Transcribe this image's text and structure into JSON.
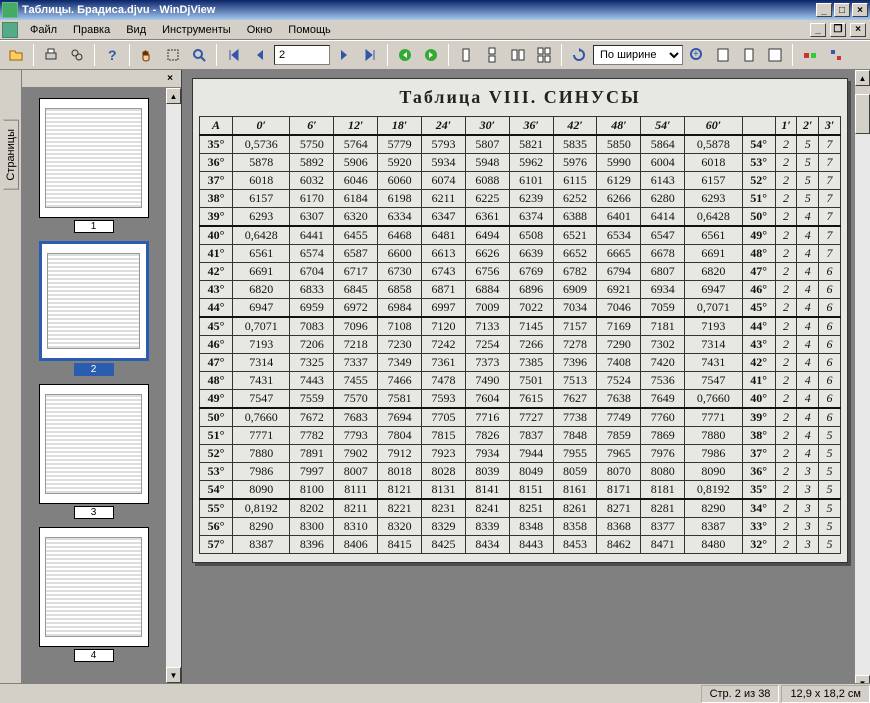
{
  "window": {
    "title": "Таблицы. Брадиса.djvu - WinDjView"
  },
  "menu": {
    "items": [
      "Файл",
      "Правка",
      "Вид",
      "Инструменты",
      "Окно",
      "Помощь"
    ]
  },
  "toolbar": {
    "page_value": "2",
    "zoom_value": "По ширине",
    "icons": {
      "open": "open-icon",
      "print": "print-icon",
      "find": "find-icon",
      "help": "help-icon",
      "hand": "hand-icon",
      "select": "select-rect-icon",
      "magnifier": "magnifier-icon",
      "first": "first-page-icon",
      "prev": "prev-page-icon",
      "next": "next-page-icon",
      "last": "last-page-icon",
      "back": "nav-back-icon",
      "forward": "nav-forward-icon",
      "single": "single-page-icon",
      "cont": "continuous-icon",
      "facing": "facing-icon",
      "cont_facing": "continuous-facing-icon",
      "rotate": "rotate-icon",
      "zoom_in": "zoom-in-icon",
      "fit_width": "fit-width-icon",
      "fit_page": "fit-page-icon",
      "actual": "actual-size-icon",
      "export": "export-icon",
      "settings": "settings-icon"
    }
  },
  "sidebar": {
    "tab_label": "Страницы",
    "close": "×"
  },
  "thumbnails": {
    "items": [
      {
        "num": "1",
        "selected": false
      },
      {
        "num": "2",
        "selected": true
      },
      {
        "num": "3",
        "selected": false
      },
      {
        "num": "4",
        "selected": false
      }
    ]
  },
  "status": {
    "page": "Стр. 2 из 38",
    "size": "12,9 x 18,2 см"
  },
  "document": {
    "title": "Таблица VIII. СИНУСЫ",
    "head": [
      "A",
      "0′",
      "6′",
      "12′",
      "18′",
      "24′",
      "30′",
      "36′",
      "42′",
      "48′",
      "54′",
      "60′",
      "",
      "1′",
      "2′",
      "3′"
    ],
    "groups": [
      [
        {
          "deg": "35°",
          "c": [
            "0,5736",
            "5750",
            "5764",
            "5779",
            "5793",
            "5807",
            "5821",
            "5835",
            "5850",
            "5864",
            "0,5878"
          ],
          "rd": "54°",
          "d": [
            "2",
            "5",
            "7"
          ]
        },
        {
          "deg": "36°",
          "c": [
            "5878",
            "5892",
            "5906",
            "5920",
            "5934",
            "5948",
            "5962",
            "5976",
            "5990",
            "6004",
            "6018"
          ],
          "rd": "53°",
          "d": [
            "2",
            "5",
            "7"
          ]
        },
        {
          "deg": "37°",
          "c": [
            "6018",
            "6032",
            "6046",
            "6060",
            "6074",
            "6088",
            "6101",
            "6115",
            "6129",
            "6143",
            "6157"
          ],
          "rd": "52°",
          "d": [
            "2",
            "5",
            "7"
          ]
        },
        {
          "deg": "38°",
          "c": [
            "6157",
            "6170",
            "6184",
            "6198",
            "6211",
            "6225",
            "6239",
            "6252",
            "6266",
            "6280",
            "6293"
          ],
          "rd": "51°",
          "d": [
            "2",
            "5",
            "7"
          ]
        },
        {
          "deg": "39°",
          "c": [
            "6293",
            "6307",
            "6320",
            "6334",
            "6347",
            "6361",
            "6374",
            "6388",
            "6401",
            "6414",
            "0,6428"
          ],
          "rd": "50°",
          "d": [
            "2",
            "4",
            "7"
          ]
        }
      ],
      [
        {
          "deg": "40°",
          "c": [
            "0,6428",
            "6441",
            "6455",
            "6468",
            "6481",
            "6494",
            "6508",
            "6521",
            "6534",
            "6547",
            "6561"
          ],
          "rd": "49°",
          "d": [
            "2",
            "4",
            "7"
          ]
        },
        {
          "deg": "41°",
          "c": [
            "6561",
            "6574",
            "6587",
            "6600",
            "6613",
            "6626",
            "6639",
            "6652",
            "6665",
            "6678",
            "6691"
          ],
          "rd": "48°",
          "d": [
            "2",
            "4",
            "7"
          ]
        },
        {
          "deg": "42°",
          "c": [
            "6691",
            "6704",
            "6717",
            "6730",
            "6743",
            "6756",
            "6769",
            "6782",
            "6794",
            "6807",
            "6820"
          ],
          "rd": "47°",
          "d": [
            "2",
            "4",
            "6"
          ]
        },
        {
          "deg": "43°",
          "c": [
            "6820",
            "6833",
            "6845",
            "6858",
            "6871",
            "6884",
            "6896",
            "6909",
            "6921",
            "6934",
            "6947"
          ],
          "rd": "46°",
          "d": [
            "2",
            "4",
            "6"
          ]
        },
        {
          "deg": "44°",
          "c": [
            "6947",
            "6959",
            "6972",
            "6984",
            "6997",
            "7009",
            "7022",
            "7034",
            "7046",
            "7059",
            "0,7071"
          ],
          "rd": "45°",
          "d": [
            "2",
            "4",
            "6"
          ]
        }
      ],
      [
        {
          "deg": "45°",
          "c": [
            "0,7071",
            "7083",
            "7096",
            "7108",
            "7120",
            "7133",
            "7145",
            "7157",
            "7169",
            "7181",
            "7193"
          ],
          "rd": "44°",
          "d": [
            "2",
            "4",
            "6"
          ]
        },
        {
          "deg": "46°",
          "c": [
            "7193",
            "7206",
            "7218",
            "7230",
            "7242",
            "7254",
            "7266",
            "7278",
            "7290",
            "7302",
            "7314"
          ],
          "rd": "43°",
          "d": [
            "2",
            "4",
            "6"
          ]
        },
        {
          "deg": "47°",
          "c": [
            "7314",
            "7325",
            "7337",
            "7349",
            "7361",
            "7373",
            "7385",
            "7396",
            "7408",
            "7420",
            "7431"
          ],
          "rd": "42°",
          "d": [
            "2",
            "4",
            "6"
          ]
        },
        {
          "deg": "48°",
          "c": [
            "7431",
            "7443",
            "7455",
            "7466",
            "7478",
            "7490",
            "7501",
            "7513",
            "7524",
            "7536",
            "7547"
          ],
          "rd": "41°",
          "d": [
            "2",
            "4",
            "6"
          ]
        },
        {
          "deg": "49°",
          "c": [
            "7547",
            "7559",
            "7570",
            "7581",
            "7593",
            "7604",
            "7615",
            "7627",
            "7638",
            "7649",
            "0,7660"
          ],
          "rd": "40°",
          "d": [
            "2",
            "4",
            "6"
          ]
        }
      ],
      [
        {
          "deg": "50°",
          "c": [
            "0,7660",
            "7672",
            "7683",
            "7694",
            "7705",
            "7716",
            "7727",
            "7738",
            "7749",
            "7760",
            "7771"
          ],
          "rd": "39°",
          "d": [
            "2",
            "4",
            "6"
          ]
        },
        {
          "deg": "51°",
          "c": [
            "7771",
            "7782",
            "7793",
            "7804",
            "7815",
            "7826",
            "7837",
            "7848",
            "7859",
            "7869",
            "7880"
          ],
          "rd": "38°",
          "d": [
            "2",
            "4",
            "5"
          ]
        },
        {
          "deg": "52°",
          "c": [
            "7880",
            "7891",
            "7902",
            "7912",
            "7923",
            "7934",
            "7944",
            "7955",
            "7965",
            "7976",
            "7986"
          ],
          "rd": "37°",
          "d": [
            "2",
            "4",
            "5"
          ]
        },
        {
          "deg": "53°",
          "c": [
            "7986",
            "7997",
            "8007",
            "8018",
            "8028",
            "8039",
            "8049",
            "8059",
            "8070",
            "8080",
            "8090"
          ],
          "rd": "36°",
          "d": [
            "2",
            "3",
            "5"
          ]
        },
        {
          "deg": "54°",
          "c": [
            "8090",
            "8100",
            "8111",
            "8121",
            "8131",
            "8141",
            "8151",
            "8161",
            "8171",
            "8181",
            "0,8192"
          ],
          "rd": "35°",
          "d": [
            "2",
            "3",
            "5"
          ]
        }
      ],
      [
        {
          "deg": "55°",
          "c": [
            "0,8192",
            "8202",
            "8211",
            "8221",
            "8231",
            "8241",
            "8251",
            "8261",
            "8271",
            "8281",
            "8290"
          ],
          "rd": "34°",
          "d": [
            "2",
            "3",
            "5"
          ]
        },
        {
          "deg": "56°",
          "c": [
            "8290",
            "8300",
            "8310",
            "8320",
            "8329",
            "8339",
            "8348",
            "8358",
            "8368",
            "8377",
            "8387"
          ],
          "rd": "33°",
          "d": [
            "2",
            "3",
            "5"
          ]
        },
        {
          "deg": "57°",
          "c": [
            "8387",
            "8396",
            "8406",
            "8415",
            "8425",
            "8434",
            "8443",
            "8453",
            "8462",
            "8471",
            "8480"
          ],
          "rd": "32°",
          "d": [
            "2",
            "3",
            "5"
          ]
        }
      ]
    ]
  }
}
